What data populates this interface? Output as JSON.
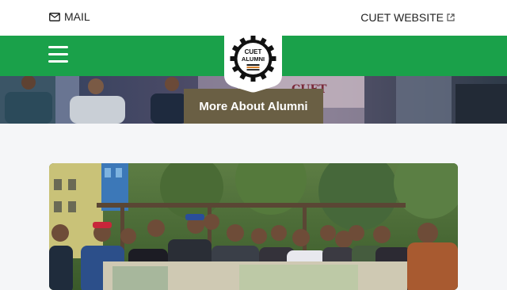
{
  "topbar": {
    "mail_label": "MAIL",
    "mail_icon": "envelope-icon",
    "website_label": "CUET WEBSITE",
    "website_icon": "external-link-icon"
  },
  "navbar": {
    "menu_icon": "hamburger-menu-icon",
    "logo_text_line1": "CUET",
    "logo_text_line2": "ALUMNI",
    "accent_color": "#1aa14a"
  },
  "hero": {
    "banner_text": "CUET",
    "cta_label": "More About Alumni",
    "cta_color": "#6a5f44"
  }
}
